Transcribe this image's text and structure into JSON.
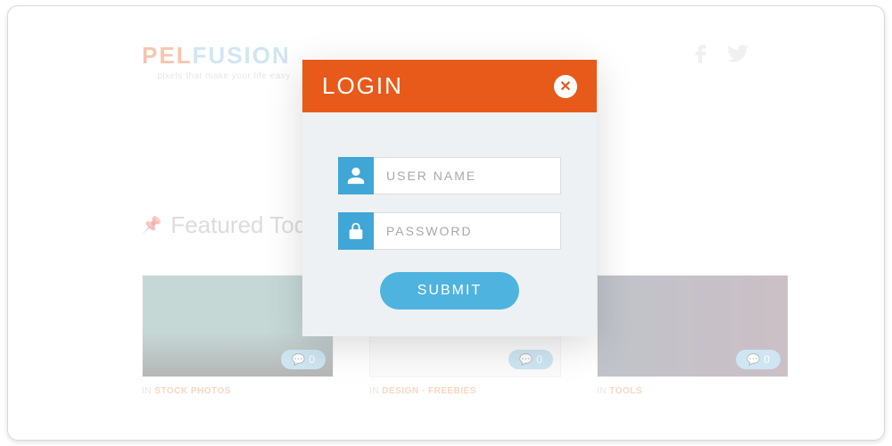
{
  "header": {
    "logo_main": "PELFUSION",
    "logo_tag": "pixels that make your life easy"
  },
  "featured": {
    "label": "Featured Today"
  },
  "cards": [
    {
      "comment_count": "0",
      "meta_in": "IN",
      "meta_cat": "STOCK PHOTOS"
    },
    {
      "comment_count": "0",
      "meta_in": "IN",
      "meta_cat": "DESIGN · FREEBIES"
    },
    {
      "comment_count": "0",
      "meta_in": "IN",
      "meta_cat": "TOOLS"
    }
  ],
  "modal": {
    "title": "LOGIN",
    "username_placeholder": "USER NAME",
    "password_placeholder": "PASSWORD",
    "submit_label": "SUBMIT"
  }
}
